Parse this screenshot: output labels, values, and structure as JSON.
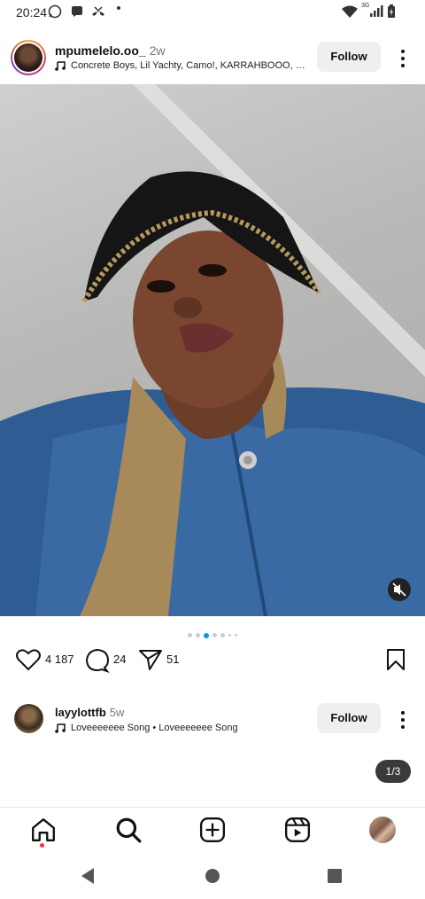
{
  "status_bar": {
    "time": "20:24",
    "network": "3G"
  },
  "post": {
    "username": "mpumelelo.oo_",
    "age": "2w",
    "music": "Concrete Boys, Lil Yachty, Camo!, KARRAHBOOO, Dc...",
    "follow_label": "Follow",
    "carousel": {
      "total_dots": 7,
      "active_index": 2
    },
    "likes": "4 187",
    "comments": "24",
    "shares": "51"
  },
  "next_post": {
    "username": "layylottfb",
    "age": "5w",
    "music": "Loveeeeeee Song • Loveeeeeee Song",
    "follow_label": "Follow",
    "counter": "1/3"
  },
  "icons": {
    "like": "heart-icon",
    "comment": "comment-icon",
    "share": "send-icon",
    "save": "bookmark-icon",
    "home": "home-icon",
    "search": "search-icon",
    "create": "plus-square-icon",
    "reels": "reels-icon"
  },
  "colors": {
    "accent": "#0095f6",
    "notification": "#ff3040",
    "follow_bg": "#efefef"
  }
}
